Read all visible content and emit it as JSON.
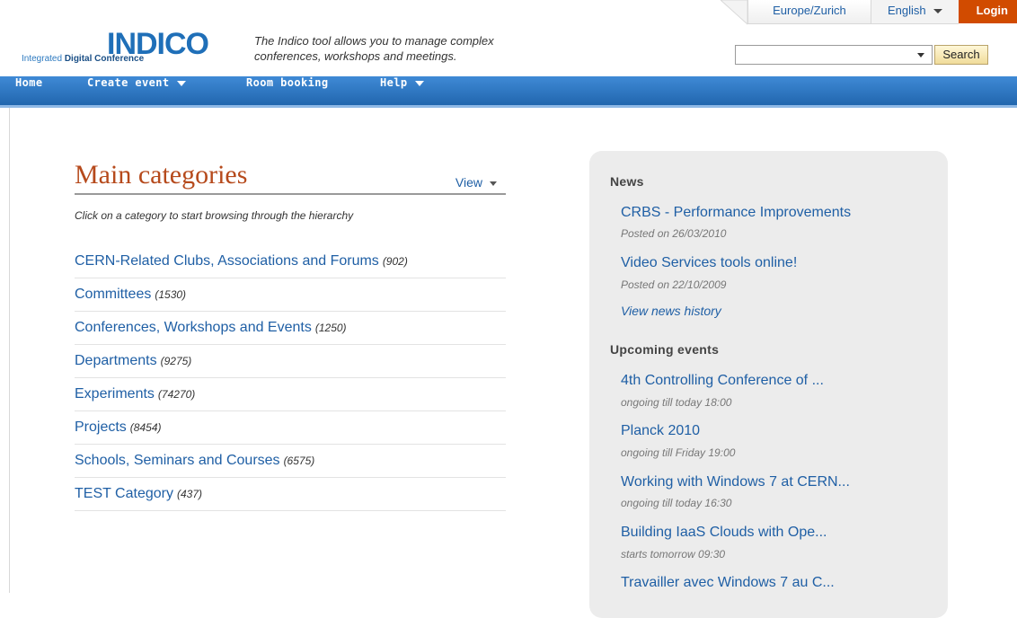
{
  "header": {
    "logo_text": "INDICO",
    "logo_tag_1": "Integrated ",
    "logo_tag_2": "Digital Conference",
    "tagline": "The Indico tool allows you to manage complex conferences, workshops and meetings.",
    "timezone": "Europe/Zurich",
    "language": "English",
    "login": "Login",
    "search_value": "",
    "search_button": "Search"
  },
  "nav": {
    "home": "Home",
    "create_event": "Create event",
    "room_booking": "Room booking",
    "help": "Help"
  },
  "categories": {
    "title": "Main categories",
    "view": "View",
    "hint": "Click on a category to start browsing through the hierarchy",
    "items": [
      {
        "label": "CERN-Related Clubs, Associations and Forums",
        "count": "(902)"
      },
      {
        "label": "Committees",
        "count": "(1530)"
      },
      {
        "label": "Conferences, Workshops and Events",
        "count": "(1250)"
      },
      {
        "label": "Departments",
        "count": "(9275)"
      },
      {
        "label": "Experiments",
        "count": "(74270)"
      },
      {
        "label": "Projects",
        "count": "(8454)"
      },
      {
        "label": "Schools, Seminars and Courses",
        "count": "(6575)"
      },
      {
        "label": "TEST Category",
        "count": "(437)"
      }
    ]
  },
  "news": {
    "heading": "News",
    "items": [
      {
        "title": "CRBS - Performance Improvements",
        "date": "Posted on 26/03/2010"
      },
      {
        "title": "Video Services tools online!",
        "date": "Posted on 22/10/2009"
      }
    ],
    "history": "View news history"
  },
  "upcoming": {
    "heading": "Upcoming events",
    "items": [
      {
        "title": "4th Controlling Conference of ...",
        "when": "ongoing till today 18:00"
      },
      {
        "title": "Planck 2010",
        "when": "ongoing till Friday 19:00"
      },
      {
        "title": "Working with Windows 7 at CERN...",
        "when": "ongoing till today 16:30"
      },
      {
        "title": "Building IaaS Clouds with Ope...",
        "when": "starts tomorrow 09:30"
      },
      {
        "title": "Travailler avec Windows 7 au C...",
        "when": ""
      }
    ]
  }
}
